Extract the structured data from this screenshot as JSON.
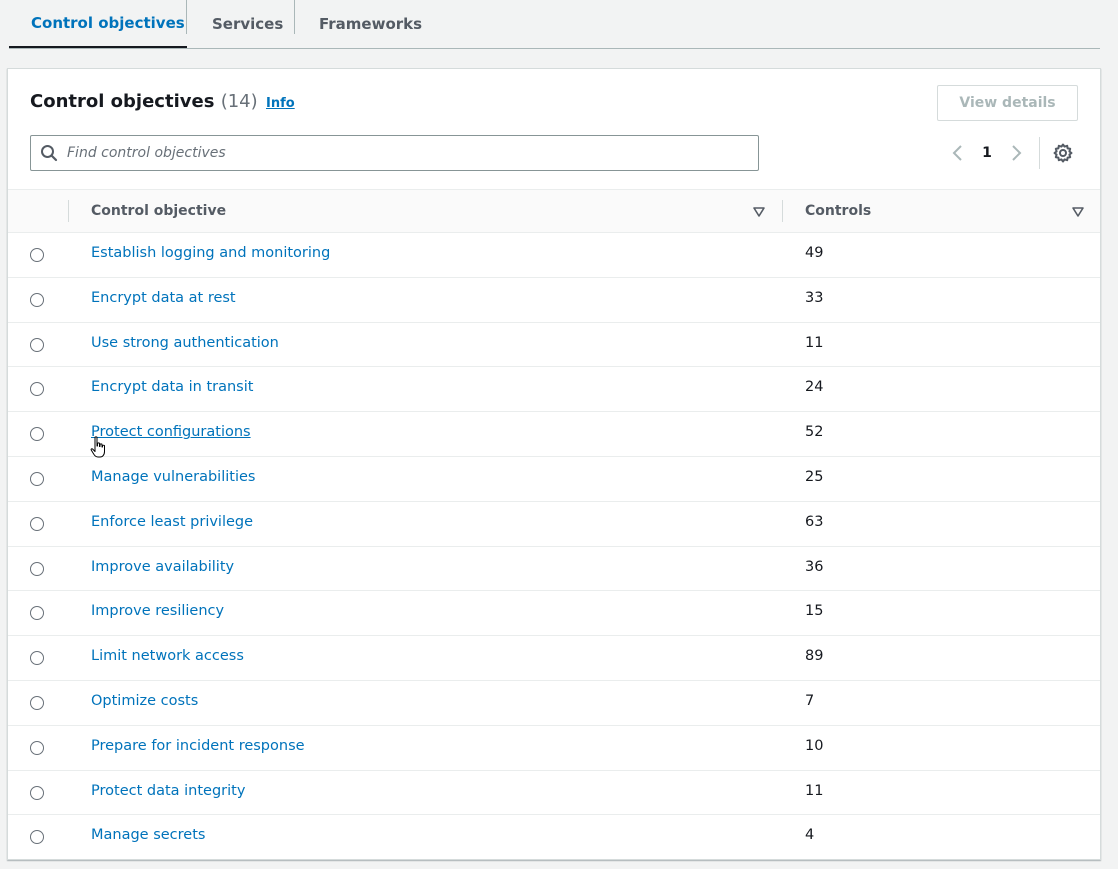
{
  "tabs": [
    {
      "label": "Control objectives",
      "active": true
    },
    {
      "label": "Services",
      "active": false
    },
    {
      "label": "Frameworks",
      "active": false
    }
  ],
  "panel": {
    "title": "Control objectives",
    "count": "(14)",
    "info_label": "Info",
    "view_details_label": "View details",
    "search_placeholder": "Find control objectives",
    "search_value": "",
    "current_page": "1"
  },
  "table": {
    "columns": [
      "Control objective",
      "Controls"
    ],
    "rows": [
      {
        "objective": "Establish logging and monitoring",
        "controls": "49"
      },
      {
        "objective": "Encrypt data at rest",
        "controls": "33"
      },
      {
        "objective": "Use strong authentication",
        "controls": "11"
      },
      {
        "objective": "Encrypt data in transit",
        "controls": "24"
      },
      {
        "objective": "Protect configurations",
        "controls": "52",
        "hovered": true
      },
      {
        "objective": "Manage vulnerabilities",
        "controls": "25"
      },
      {
        "objective": "Enforce least privilege",
        "controls": "63"
      },
      {
        "objective": "Improve availability",
        "controls": "36"
      },
      {
        "objective": "Improve resiliency",
        "controls": "15"
      },
      {
        "objective": "Limit network access",
        "controls": "89"
      },
      {
        "objective": "Optimize costs",
        "controls": "7"
      },
      {
        "objective": "Prepare for incident response",
        "controls": "10"
      },
      {
        "objective": "Protect data integrity",
        "controls": "11"
      },
      {
        "objective": "Manage secrets",
        "controls": "4"
      }
    ]
  },
  "colors": {
    "link": "#0073bb",
    "active_tab_text": "#0073bb",
    "text": "#16191f",
    "muted": "#687078",
    "disabled": "#aab7b8"
  },
  "icons": [
    "search-icon",
    "chevron-left-icon",
    "chevron-right-icon",
    "gear-icon",
    "sort-down-icon",
    "pointer-cursor-icon"
  ]
}
